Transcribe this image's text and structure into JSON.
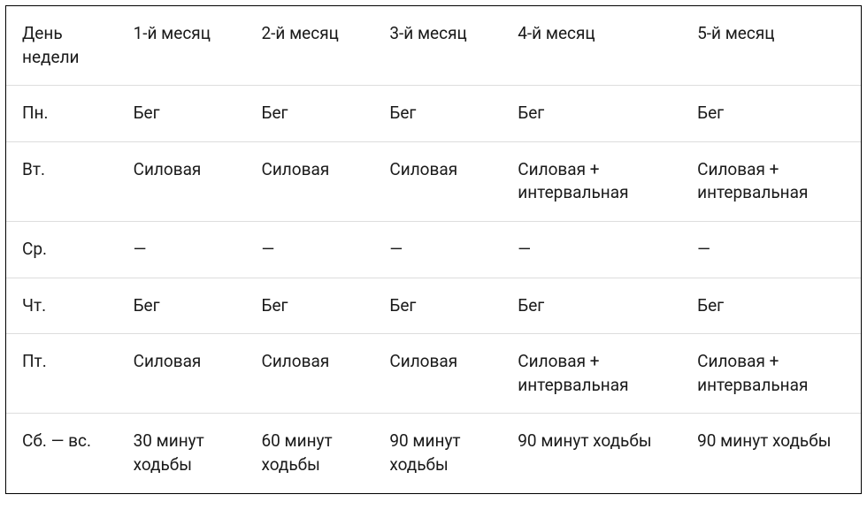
{
  "table": {
    "headers": [
      "День недели",
      "1-й месяц",
      "2-й месяц",
      "3-й месяц",
      "4-й месяц",
      "5-й месяц"
    ],
    "rows": [
      [
        "Пн.",
        "Бег",
        "Бег",
        "Бег",
        "Бег",
        "Бег"
      ],
      [
        "Вт.",
        "Силовая",
        "Силовая",
        "Силовая",
        "Силовая + интервальная",
        "Силовая + интервальная"
      ],
      [
        "Ср.",
        "—",
        "—",
        "—",
        "—",
        "—"
      ],
      [
        "Чт.",
        "Бег",
        "Бег",
        "Бег",
        "Бег",
        "Бег"
      ],
      [
        "Пт.",
        "Силовая",
        "Силовая",
        "Силовая",
        "Силовая + интервальная",
        "Силовая + интервальная"
      ],
      [
        "Сб. — вс.",
        "30 минут ходьбы",
        "60 минут ходьбы",
        "90 минут ходьбы",
        "90 минут ходьбы",
        "90 минут ходьбы"
      ]
    ]
  }
}
